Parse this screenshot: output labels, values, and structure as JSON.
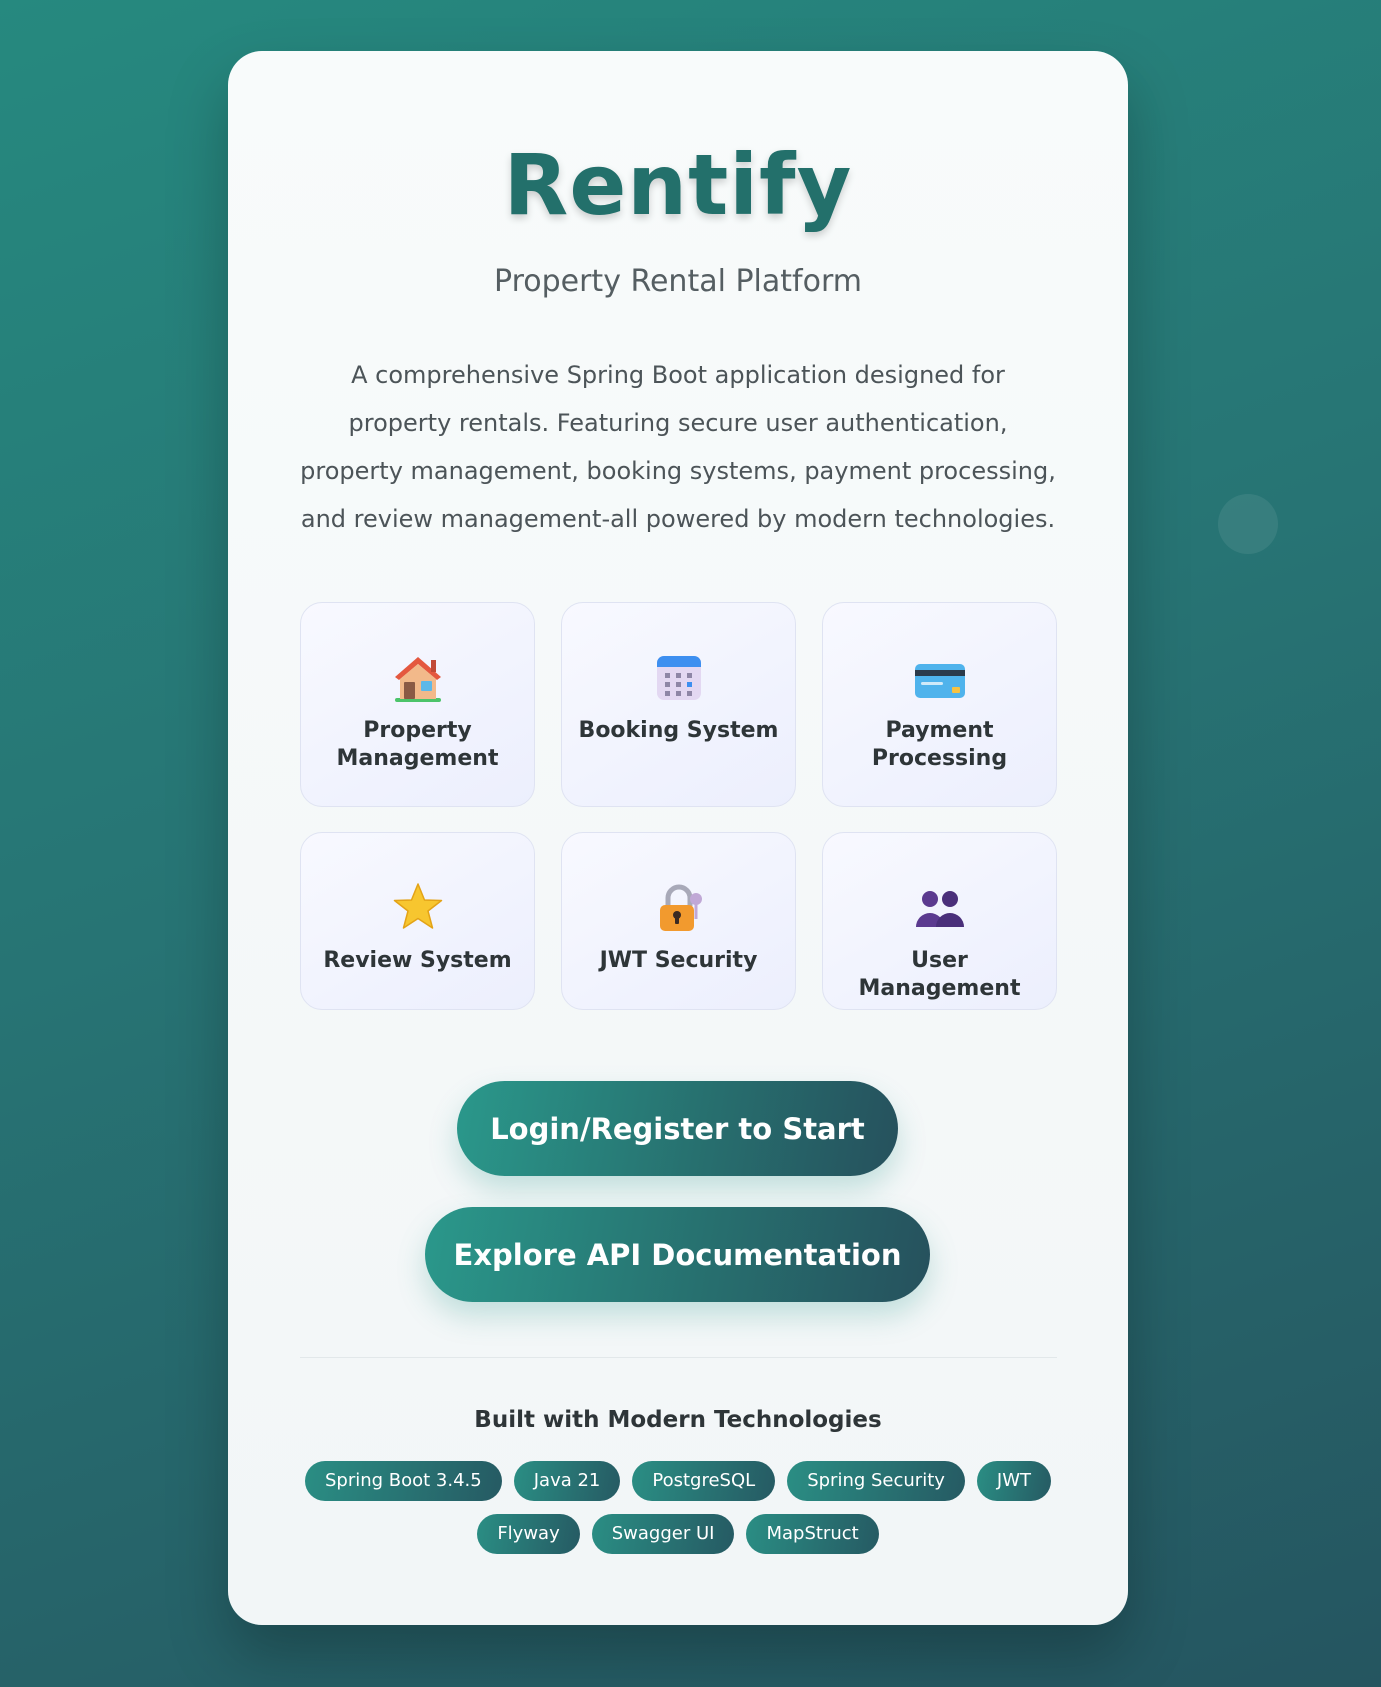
{
  "header": {
    "title": "Rentify",
    "subtitle": "Property Rental Platform"
  },
  "description": "A comprehensive Spring Boot application designed for property rentals. Featuring secure user authentication, property management, booking systems, payment processing, and review management-all powered by modern technologies.",
  "features": [
    {
      "label": "Property Management",
      "icon": "house-icon"
    },
    {
      "label": "Booking System",
      "icon": "calendar-icon"
    },
    {
      "label": "Payment Processing",
      "icon": "credit-card-icon"
    },
    {
      "label": "Review System",
      "icon": "star-icon"
    },
    {
      "label": "JWT Security",
      "icon": "lock-key-icon"
    },
    {
      "label": "User Management",
      "icon": "users-icon"
    }
  ],
  "actions": {
    "login_label": "Login/Register to Start",
    "api_docs_label": "Explore API Documentation"
  },
  "tech": {
    "heading": "Built with Modern Technologies",
    "items": [
      "Spring Boot 3.4.5",
      "Java 21",
      "PostgreSQL",
      "Spring Security",
      "JWT",
      "Flyway",
      "Swagger UI",
      "MapStruct"
    ]
  },
  "colors": {
    "brand": "#23706b",
    "button_start": "#2a988b",
    "button_end": "#26515d"
  }
}
